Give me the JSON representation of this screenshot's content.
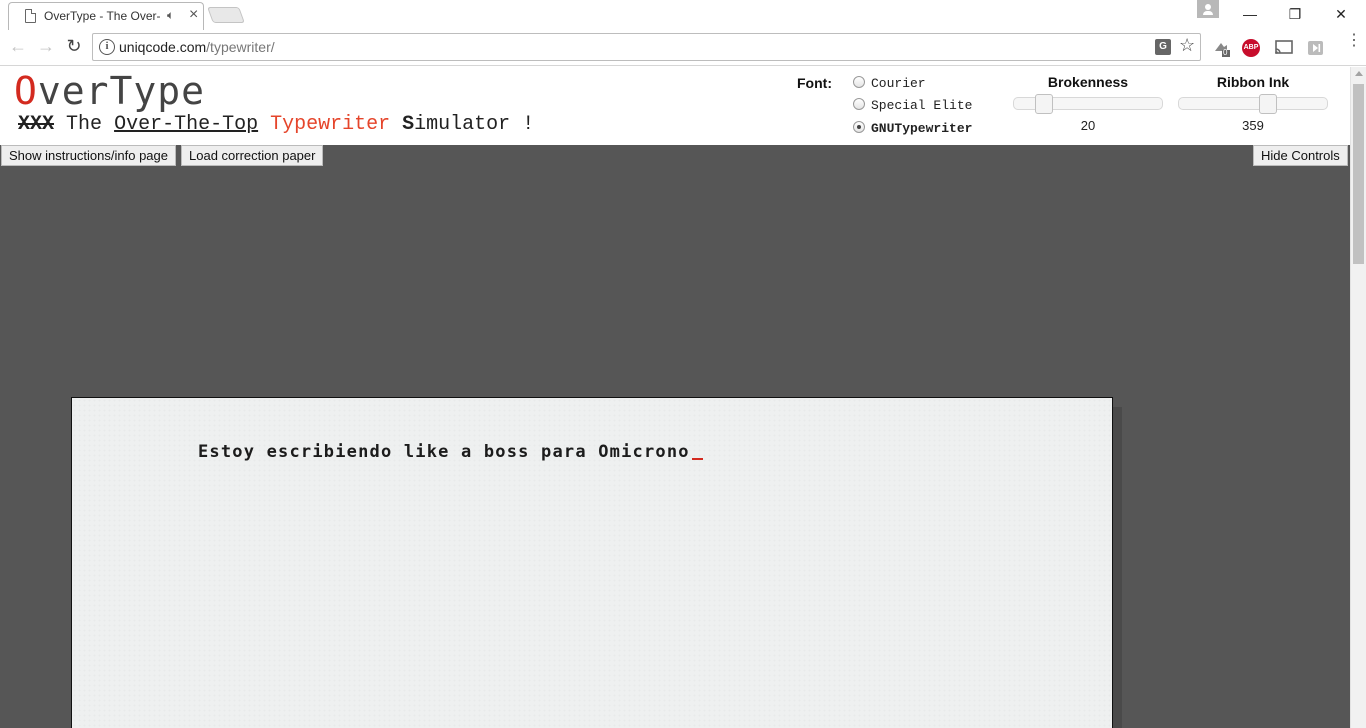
{
  "browser": {
    "tab_title": "OverType - The Over-",
    "url_host": "uniqcode.com",
    "url_path": "/typewriter/",
    "window_buttons": {
      "minimize": "—",
      "restore": "❐",
      "close": "✕"
    },
    "extensions": {
      "abp_label": "ABP",
      "badge_count": "0"
    },
    "nav": {
      "back": "←",
      "forward": "→",
      "reload": "↻"
    }
  },
  "header": {
    "logo": {
      "before": "",
      "red_o": "O",
      "after": "verType"
    },
    "subtitle": {
      "xxx": "XXX",
      "the": "The",
      "over_the_top": "Over-The-Top",
      "typewriter": "Typewriter",
      "s": "S",
      "imulator": "imulator",
      "bang": "!"
    }
  },
  "controls": {
    "font_label": "Font:",
    "fonts": [
      {
        "label": "Courier",
        "checked": false
      },
      {
        "label": "Special Elite",
        "checked": false
      },
      {
        "label": "GNUTypewriter",
        "checked": true
      }
    ],
    "brokenness": {
      "title": "Brokenness",
      "value": "20"
    },
    "ribbon_ink": {
      "title": "Ribbon Ink",
      "value": "359"
    },
    "buttons": {
      "instructions": "Show instructions/info page",
      "correction": "Load correction paper",
      "hide": "Hide Controls"
    }
  },
  "paper": {
    "typed_text": "Estoy escribiendo like a boss para Omicrono"
  },
  "colors": {
    "accent_red": "#d32a1f",
    "page_bg": "#565656",
    "paper_bg": "#eef0f0"
  }
}
